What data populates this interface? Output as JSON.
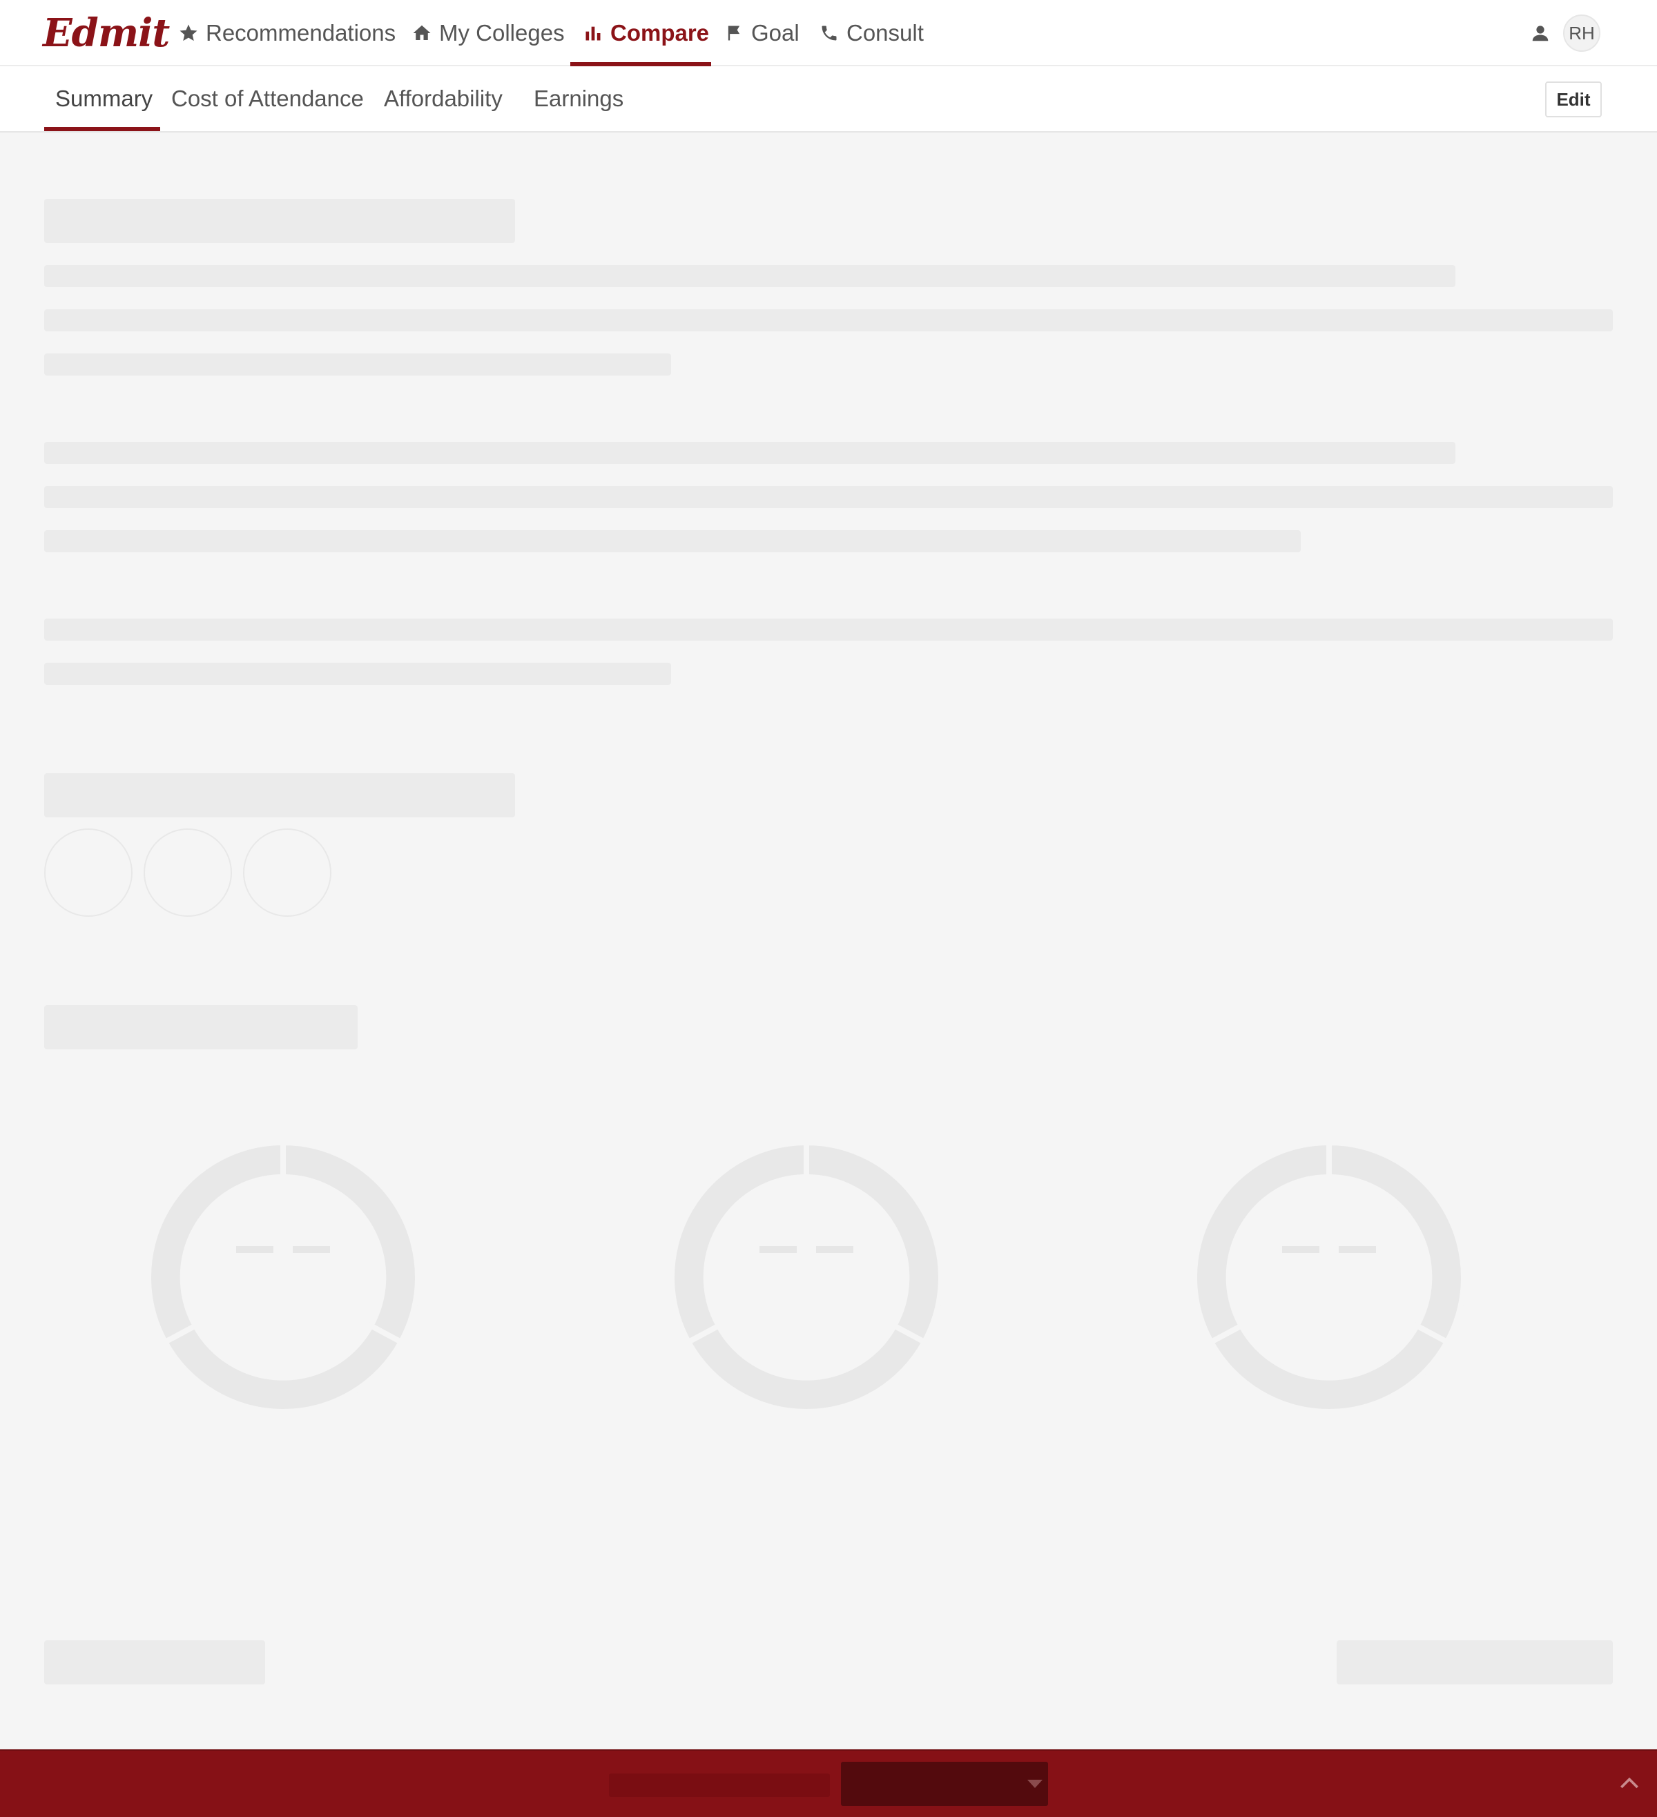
{
  "brand": {
    "logo_text": "Edmit",
    "accent_color": "#8b1318"
  },
  "topnav": {
    "items": [
      {
        "label": "Recommendations",
        "icon": "star-icon"
      },
      {
        "label": "My Colleges",
        "icon": "home-icon"
      },
      {
        "label": "Compare",
        "icon": "bar-chart-icon",
        "active": true
      },
      {
        "label": "Goal",
        "icon": "flag-icon"
      },
      {
        "label": "Consult",
        "icon": "phone-icon"
      }
    ],
    "user_icon": "person-icon",
    "avatar_initials": "RH"
  },
  "subnav": {
    "tabs": [
      {
        "label": "Summary",
        "active": true
      },
      {
        "label": "Cost of Attendance"
      },
      {
        "label": "Affordability"
      },
      {
        "label": "Earnings"
      }
    ],
    "edit_label": "Edit"
  },
  "content": {
    "state": "loading-skeleton"
  },
  "bottombar": {
    "color": "#861116",
    "expand_icon": "chevron-up-icon"
  }
}
